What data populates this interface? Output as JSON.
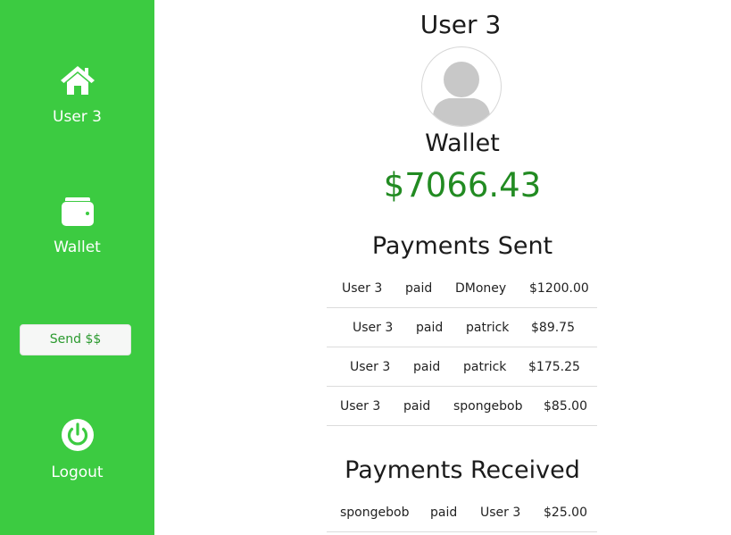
{
  "sidebar": {
    "home": {
      "icon": "home-icon",
      "label": "User 3"
    },
    "wallet": {
      "icon": "wallet-icon",
      "label": "Wallet"
    },
    "send_button": "Send $$",
    "logout": {
      "icon": "power-icon",
      "label": "Logout"
    },
    "background_color": "#3ccb41"
  },
  "main": {
    "user_name": "User 3",
    "avatar_icon": "avatar-placeholder-icon",
    "wallet_title": "Wallet",
    "balance": "$7066.43",
    "balance_color": "#228b22",
    "payments_sent_title": "Payments Sent",
    "payments_sent": [
      {
        "from": "User 3",
        "verb": "paid",
        "to": "DMoney",
        "amount": "$1200.00"
      },
      {
        "from": "User 3",
        "verb": "paid",
        "to": "patrick",
        "amount": "$89.75"
      },
      {
        "from": "User 3",
        "verb": "paid",
        "to": "patrick",
        "amount": "$175.25"
      },
      {
        "from": "User 3",
        "verb": "paid",
        "to": "spongebob",
        "amount": "$85.00"
      }
    ],
    "payments_received_title": "Payments Received",
    "payments_received": [
      {
        "from": "spongebob",
        "verb": "paid",
        "to": "User 3",
        "amount": "$25.00"
      }
    ]
  }
}
